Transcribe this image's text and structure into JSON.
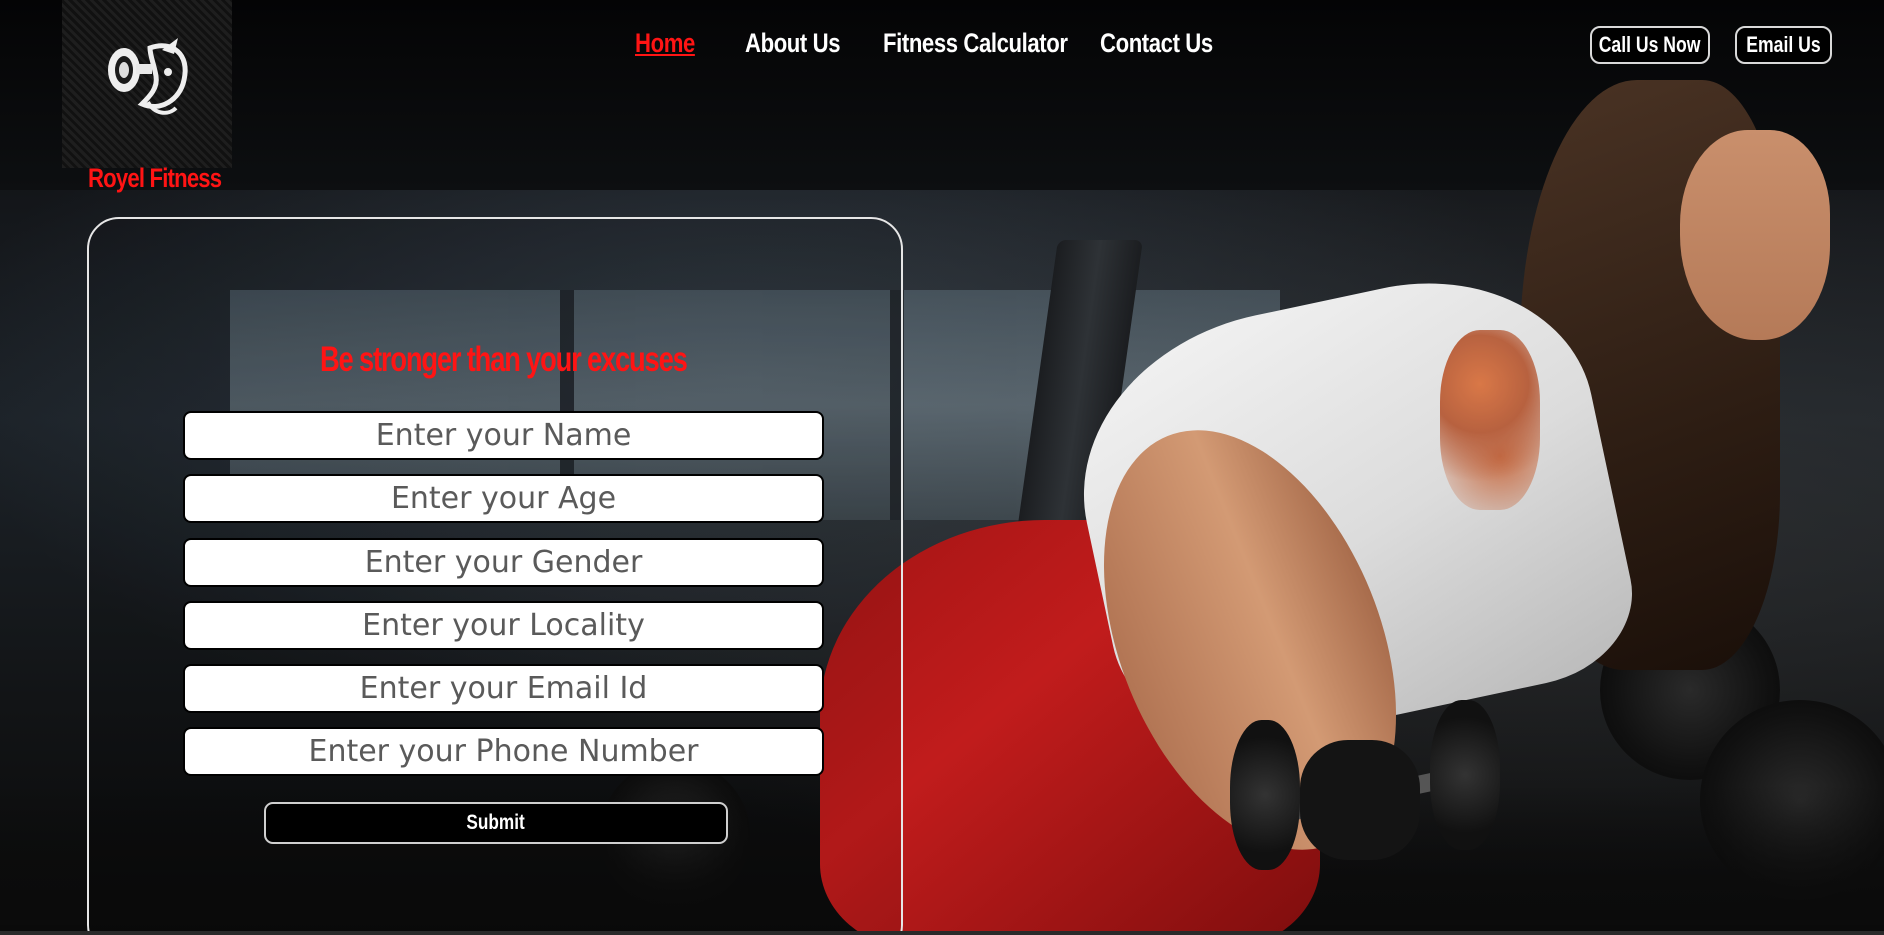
{
  "brand": {
    "name": "Royel Fitness",
    "accent_color": "#ff1414",
    "logo_icon": "dumbbell-face-logo-icon"
  },
  "nav": {
    "items": [
      {
        "label": "Home",
        "active": true
      },
      {
        "label": "About Us",
        "active": false
      },
      {
        "label": "Fitness Calculator",
        "active": false
      },
      {
        "label": "Contact Us",
        "active": false
      }
    ]
  },
  "header_buttons": {
    "call_label": "Call Us Now",
    "email_label": "Email Us"
  },
  "form": {
    "tagline": "Be stronger than your excuses",
    "fields": [
      {
        "placeholder": "Enter your Name",
        "value": ""
      },
      {
        "placeholder": "Enter your Age",
        "value": ""
      },
      {
        "placeholder": "Enter your Gender",
        "value": ""
      },
      {
        "placeholder": "Enter your Locality",
        "value": ""
      },
      {
        "placeholder": "Enter your Email Id",
        "value": ""
      },
      {
        "placeholder": "Enter your Phone Number",
        "value": ""
      }
    ],
    "submit_label": "Submit"
  }
}
